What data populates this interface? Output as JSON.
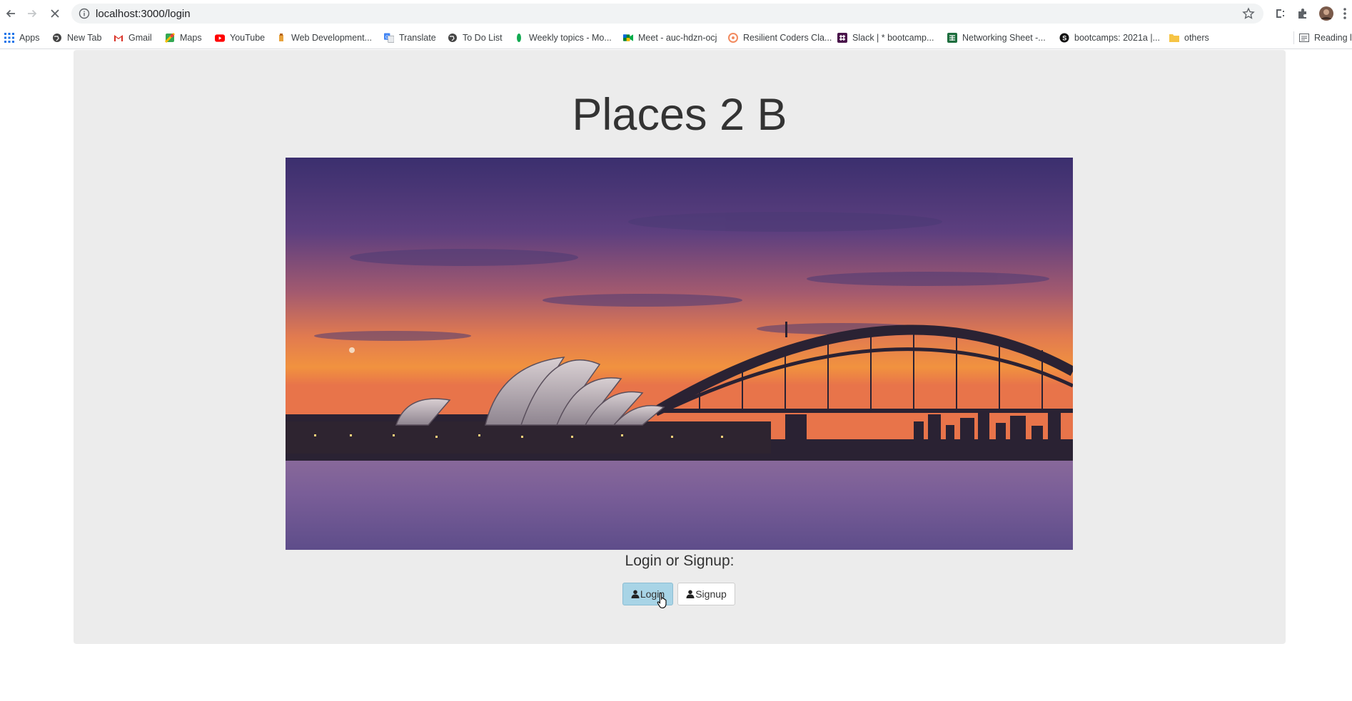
{
  "browser": {
    "url": "localhost:3000/login",
    "bookmarks": [
      {
        "label": "Apps",
        "icon": "apps-grid-icon"
      },
      {
        "label": "New Tab",
        "icon": "globe-icon"
      },
      {
        "label": "Gmail",
        "icon": "gmail-icon"
      },
      {
        "label": "Maps",
        "icon": "maps-icon"
      },
      {
        "label": "YouTube",
        "icon": "youtube-icon"
      },
      {
        "label": "Web Development...",
        "icon": "bookmark-site-icon"
      },
      {
        "label": "Translate",
        "icon": "translate-icon"
      },
      {
        "label": "To Do List",
        "icon": "globe-icon"
      },
      {
        "label": "Weekly topics - Mo...",
        "icon": "leaf-icon"
      },
      {
        "label": "Meet - auc-hdzn-ocj",
        "icon": "meet-icon"
      },
      {
        "label": "Resilient Coders Cla...",
        "icon": "resilient-icon"
      },
      {
        "label": "Slack | * bootcamp...",
        "icon": "slack-icon"
      },
      {
        "label": "Networking Sheet -...",
        "icon": "sheet-icon"
      },
      {
        "label": "bootcamps: 2021a |...",
        "icon": "skype-icon"
      },
      {
        "label": "others",
        "icon": "folder-icon"
      }
    ],
    "reading_list": "Reading lis"
  },
  "page": {
    "title": "Places 2 B",
    "prompt": "Login or Signup:",
    "login_label": "Login",
    "signup_label": "Signup"
  },
  "colors": {
    "panel": "#ececec",
    "active_button": "#a8d4e6"
  }
}
